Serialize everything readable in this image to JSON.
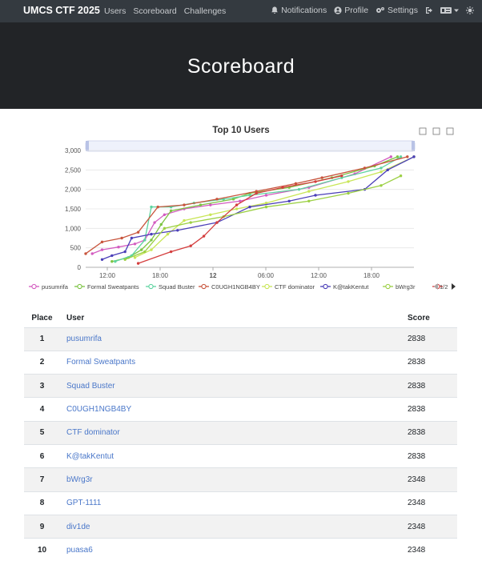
{
  "navbar": {
    "brand": "UMCS CTF 2025",
    "left_links": [
      "Users",
      "Scoreboard",
      "Challenges"
    ],
    "notifications": "Notifications",
    "profile": "Profile",
    "settings": "Settings"
  },
  "page_title": "Scoreboard",
  "chart_data": {
    "type": "line",
    "title": "Top 10 Users",
    "ylim": [
      0,
      3000
    ],
    "yticks": [
      "0",
      "500",
      "1,000",
      "1,500",
      "2,000",
      "2,500",
      "3,000"
    ],
    "xticks": [
      "12:00",
      "18:00",
      "12",
      "06:00",
      "12:00",
      "18:00"
    ],
    "legend_page": "1/2",
    "series": [
      {
        "name": "pusumrifa",
        "color": "#d35cc0",
        "points": [
          [
            0.02,
            350
          ],
          [
            0.05,
            450
          ],
          [
            0.1,
            520
          ],
          [
            0.15,
            600
          ],
          [
            0.18,
            700
          ],
          [
            0.21,
            1150
          ],
          [
            0.24,
            1350
          ],
          [
            0.3,
            1500
          ],
          [
            0.38,
            1600
          ],
          [
            0.47,
            1700
          ],
          [
            0.55,
            1850
          ],
          [
            0.68,
            2050
          ],
          [
            0.82,
            2400
          ],
          [
            0.93,
            2838
          ]
        ]
      },
      {
        "name": "Formal Sweatpants",
        "color": "#7cc443",
        "points": [
          [
            0.08,
            150
          ],
          [
            0.13,
            250
          ],
          [
            0.17,
            450
          ],
          [
            0.2,
            700
          ],
          [
            0.23,
            1100
          ],
          [
            0.26,
            1450
          ],
          [
            0.35,
            1600
          ],
          [
            0.45,
            1750
          ],
          [
            0.5,
            1900
          ],
          [
            0.62,
            2050
          ],
          [
            0.75,
            2300
          ],
          [
            0.88,
            2600
          ],
          [
            0.95,
            2838
          ]
        ]
      },
      {
        "name": "Squad Buster",
        "color": "#5fd4a0",
        "points": [
          [
            0.09,
            150
          ],
          [
            0.14,
            300
          ],
          [
            0.18,
            700
          ],
          [
            0.2,
            1550
          ],
          [
            0.26,
            1550
          ],
          [
            0.33,
            1650
          ],
          [
            0.42,
            1750
          ],
          [
            0.5,
            1850
          ],
          [
            0.65,
            2000
          ],
          [
            0.78,
            2300
          ],
          [
            0.9,
            2550
          ],
          [
            0.96,
            2838
          ]
        ]
      },
      {
        "name": "C0UGH1NGB4BY",
        "color": "#c8553d",
        "points": [
          [
            0.0,
            350
          ],
          [
            0.05,
            650
          ],
          [
            0.11,
            750
          ],
          [
            0.16,
            900
          ],
          [
            0.22,
            1550
          ],
          [
            0.3,
            1600
          ],
          [
            0.4,
            1750
          ],
          [
            0.52,
            1950
          ],
          [
            0.64,
            2150
          ],
          [
            0.72,
            2300
          ],
          [
            0.85,
            2550
          ],
          [
            0.98,
            2838
          ]
        ]
      },
      {
        "name": "CTF dominator",
        "color": "#c9e657",
        "points": [
          [
            0.15,
            250
          ],
          [
            0.2,
            450
          ],
          [
            0.25,
            850
          ],
          [
            0.3,
            1200
          ],
          [
            0.38,
            1350
          ],
          [
            0.46,
            1500
          ],
          [
            0.55,
            1650
          ],
          [
            0.68,
            1950
          ],
          [
            0.8,
            2200
          ],
          [
            0.9,
            2450
          ],
          [
            1.02,
            2838
          ]
        ]
      },
      {
        "name": "K@takKentut",
        "color": "#4b3fb8",
        "points": [
          [
            0.05,
            200
          ],
          [
            0.08,
            300
          ],
          [
            0.12,
            400
          ],
          [
            0.14,
            750
          ],
          [
            0.2,
            850
          ],
          [
            0.28,
            950
          ],
          [
            0.4,
            1150
          ],
          [
            0.5,
            1550
          ],
          [
            0.62,
            1700
          ],
          [
            0.7,
            1850
          ],
          [
            0.85,
            2000
          ],
          [
            0.92,
            2500
          ],
          [
            1.02,
            2838
          ]
        ]
      },
      {
        "name": "bWrg3r",
        "color": "#9cd044",
        "points": [
          [
            0.12,
            200
          ],
          [
            0.18,
            400
          ],
          [
            0.24,
            1000
          ],
          [
            0.32,
            1150
          ],
          [
            0.42,
            1300
          ],
          [
            0.55,
            1550
          ],
          [
            0.68,
            1700
          ],
          [
            0.8,
            1900
          ],
          [
            0.9,
            2100
          ],
          [
            0.96,
            2348
          ]
        ]
      },
      {
        "name": "GPT-1111",
        "color": "#d43e3e",
        "points": [
          [
            0.16,
            100
          ],
          [
            0.26,
            400
          ],
          [
            0.32,
            550
          ],
          [
            0.36,
            800
          ],
          [
            0.4,
            1150
          ],
          [
            0.46,
            1600
          ],
          [
            0.52,
            1900
          ],
          [
            0.6,
            2050
          ],
          [
            0.7,
            2200
          ],
          [
            0.78,
            2348
          ]
        ]
      }
    ]
  },
  "table": {
    "headers": {
      "place": "Place",
      "user": "User",
      "score": "Score"
    },
    "rows": [
      {
        "place": "1",
        "user": "pusumrifa",
        "score": "2838"
      },
      {
        "place": "2",
        "user": "Formal Sweatpants",
        "score": "2838"
      },
      {
        "place": "3",
        "user": "Squad Buster",
        "score": "2838"
      },
      {
        "place": "4",
        "user": "C0UGH1NGB4BY",
        "score": "2838"
      },
      {
        "place": "5",
        "user": "CTF dominator",
        "score": "2838"
      },
      {
        "place": "6",
        "user": "K@takKentut",
        "score": "2838"
      },
      {
        "place": "7",
        "user": "bWrg3r",
        "score": "2348"
      },
      {
        "place": "8",
        "user": "GPT-1111",
        "score": "2348"
      },
      {
        "place": "9",
        "user": "div1de",
        "score": "2348"
      },
      {
        "place": "10",
        "user": "puasa6",
        "score": "2348"
      }
    ]
  }
}
